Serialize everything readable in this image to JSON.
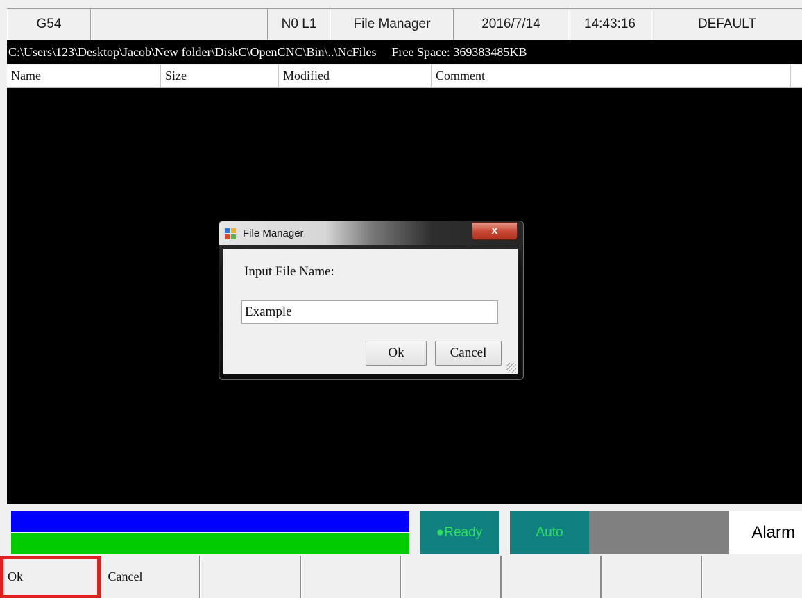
{
  "header": {
    "coord": "G54",
    "blank": "",
    "line": "N0 L1",
    "title": "File Manager",
    "date": "2016/7/14",
    "time": "14:43:16",
    "profile": "DEFAULT"
  },
  "pathbar": {
    "path": "C:\\Users\\123\\Desktop\\Jacob\\New folder\\DiskC\\OpenCNC\\Bin\\..\\NcFiles",
    "free_space": "Free Space: 369383485KB"
  },
  "file_list": {
    "columns": [
      "Name",
      "Size",
      "Modified",
      "Comment"
    ],
    "rows": []
  },
  "dialog": {
    "title": "File Manager",
    "close_glyph": "x",
    "label": "Input File Name:",
    "input_value": "Example",
    "ok_label": "Ok",
    "cancel_label": "Cancel"
  },
  "status": {
    "ready": "●Ready",
    "mode": "Auto",
    "alarm": "Alarm",
    "colors": {
      "blue_bar": "#0000ff",
      "green_bar": "#00cc00",
      "teal": "#108080",
      "status_text": "#2de05a"
    }
  },
  "softkeys": [
    "Ok",
    "Cancel",
    "",
    "",
    "",
    "",
    "",
    ""
  ],
  "highlight": {
    "selected_softkey": "Ok",
    "color": "#e02020"
  }
}
